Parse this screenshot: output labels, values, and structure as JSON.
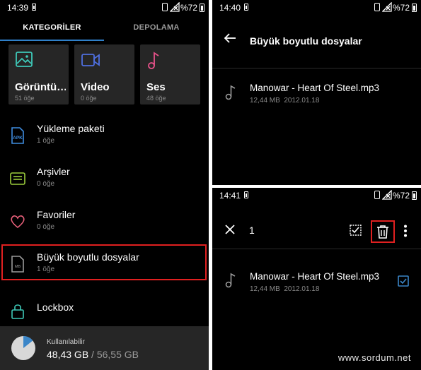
{
  "left": {
    "status": {
      "time": "14:39",
      "battery": "%72"
    },
    "tabs": [
      {
        "label": "KATEGORİLER"
      },
      {
        "label": "DEPOLAMA"
      }
    ],
    "tiles": [
      {
        "label": "Görüntü…",
        "count": "51 öğe",
        "icon": "image-icon",
        "color": "#3ec9b8"
      },
      {
        "label": "Video",
        "count": "0 öğe",
        "icon": "video-icon",
        "color": "#4f6fe0"
      },
      {
        "label": "Ses",
        "count": "48 öğe",
        "icon": "music-note-icon",
        "color": "#e8528a"
      }
    ],
    "rows": [
      {
        "title": "Yükleme paketi",
        "sub": "1 öğe",
        "icon": "apk-icon",
        "color": "#3f8de0"
      },
      {
        "title": "Arşivler",
        "sub": "0 öğe",
        "icon": "archive-icon",
        "color": "#9ccd3c"
      },
      {
        "title": "Favoriler",
        "sub": "0 öğe",
        "icon": "heart-icon",
        "color": "#e8607a"
      },
      {
        "title": "Büyük boyutlu dosyalar",
        "sub": "1 öğe",
        "icon": "large-file-icon",
        "color": "#9a9a9a"
      },
      {
        "title": "Lockbox",
        "sub": "",
        "icon": "lock-icon",
        "color": "#3ec9b8"
      }
    ],
    "storage": {
      "label": "Kullanılabilir",
      "used": "48,43 GB",
      "separator": " / ",
      "total": "56,55 GB",
      "fill_fraction": 0.143,
      "accent": "#3b86c8"
    }
  },
  "top_right": {
    "status": {
      "time": "14:40",
      "battery": "%72"
    },
    "title": "Büyük boyutlu dosyalar",
    "file": {
      "name": "Manowar - Heart Of Steel.mp3",
      "size": "12,44 MB",
      "date": "2012.01.18"
    }
  },
  "bottom_right": {
    "status": {
      "time": "14:41",
      "battery": "%72"
    },
    "selected_count": "1",
    "file": {
      "name": "Manowar - Heart Of Steel.mp3",
      "size": "12,44 MB",
      "date": "2012.01.18",
      "checked": true
    },
    "checkbox_color": "#3b86c8"
  },
  "watermark": "www.sordum.net",
  "colors": {
    "highlight": "#e02020",
    "tab_indicator": "#2f80c9"
  }
}
